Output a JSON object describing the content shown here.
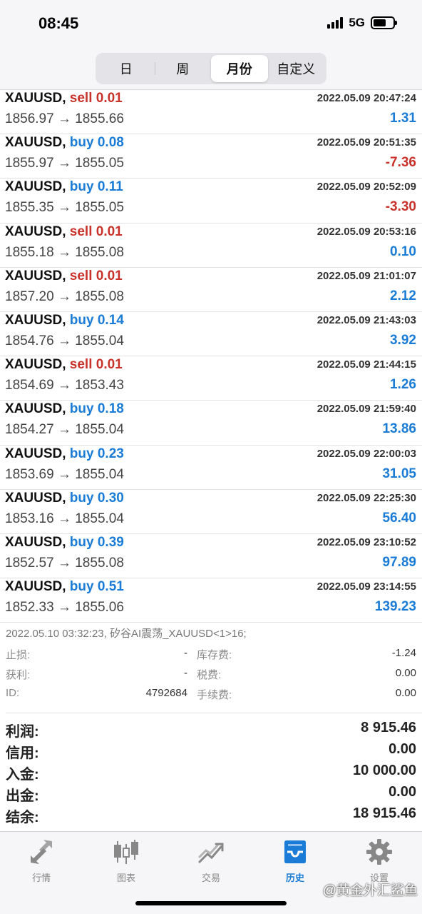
{
  "status_bar": {
    "time": "08:45",
    "network": "5G"
  },
  "segments": [
    {
      "label": "日",
      "active": false
    },
    {
      "label": "周",
      "active": false
    },
    {
      "label": "月份",
      "active": true
    },
    {
      "label": "自定义",
      "active": false
    }
  ],
  "trades": [
    {
      "symbol": "XAUUSD,",
      "side": "sell",
      "volume": "sell 0.01",
      "time": "2022.05.09 20:47:24",
      "prices": "1856.97 → 1855.66",
      "profit": "1.31"
    },
    {
      "symbol": "XAUUSD,",
      "side": "buy",
      "volume": "buy 0.08",
      "time": "2022.05.09 20:51:35",
      "prices": "1855.97 → 1855.05",
      "profit": "-7.36"
    },
    {
      "symbol": "XAUUSD,",
      "side": "buy",
      "volume": "buy 0.11",
      "time": "2022.05.09 20:52:09",
      "prices": "1855.35 → 1855.05",
      "profit": "-3.30"
    },
    {
      "symbol": "XAUUSD,",
      "side": "sell",
      "volume": "sell 0.01",
      "time": "2022.05.09 20:53:16",
      "prices": "1855.18 → 1855.08",
      "profit": "0.10"
    },
    {
      "symbol": "XAUUSD,",
      "side": "sell",
      "volume": "sell 0.01",
      "time": "2022.05.09 21:01:07",
      "prices": "1857.20 → 1855.08",
      "profit": "2.12"
    },
    {
      "symbol": "XAUUSD,",
      "side": "buy",
      "volume": "buy 0.14",
      "time": "2022.05.09 21:43:03",
      "prices": "1854.76 → 1855.04",
      "profit": "3.92"
    },
    {
      "symbol": "XAUUSD,",
      "side": "sell",
      "volume": "sell 0.01",
      "time": "2022.05.09 21:44:15",
      "prices": "1854.69 → 1853.43",
      "profit": "1.26"
    },
    {
      "symbol": "XAUUSD,",
      "side": "buy",
      "volume": "buy 0.18",
      "time": "2022.05.09 21:59:40",
      "prices": "1854.27 → 1855.04",
      "profit": "13.86"
    },
    {
      "symbol": "XAUUSD,",
      "side": "buy",
      "volume": "buy 0.23",
      "time": "2022.05.09 22:00:03",
      "prices": "1853.69 → 1855.04",
      "profit": "31.05"
    },
    {
      "symbol": "XAUUSD,",
      "side": "buy",
      "volume": "buy 0.30",
      "time": "2022.05.09 22:25:30",
      "prices": "1853.16 → 1855.04",
      "profit": "56.40"
    },
    {
      "symbol": "XAUUSD,",
      "side": "buy",
      "volume": "buy 0.39",
      "time": "2022.05.09 23:10:52",
      "prices": "1852.57 → 1855.08",
      "profit": "97.89"
    },
    {
      "symbol": "XAUUSD,",
      "side": "buy",
      "volume": "buy 0.51",
      "time": "2022.05.09 23:14:55",
      "prices": "1852.33 → 1855.06",
      "profit": "139.23"
    }
  ],
  "order_detail": {
    "line": "2022.05.10 03:32:23, 矽谷AI震荡_XAUUSD<1>16;",
    "rows": [
      {
        "label1": "止损:",
        "value1": "-",
        "label2": "库存费:",
        "value2": "-1.24"
      },
      {
        "label1": "获利:",
        "value1": "-",
        "label2": "税费:",
        "value2": "0.00"
      },
      {
        "label1": "ID:",
        "value1": "4792684",
        "label2": "手续费:",
        "value2": "0.00"
      }
    ]
  },
  "summary": [
    {
      "label": "利润:",
      "value": "8 915.46"
    },
    {
      "label": "信用:",
      "value": "0.00"
    },
    {
      "label": "入金:",
      "value": "10 000.00"
    },
    {
      "label": "出金:",
      "value": "0.00"
    },
    {
      "label": "结余:",
      "value": "18 915.46"
    }
  ],
  "tabbar": [
    {
      "label": "行情",
      "icon": "quotes-arrows-icon",
      "active": false
    },
    {
      "label": "图表",
      "icon": "candlestick-chart-icon",
      "active": false
    },
    {
      "label": "交易",
      "icon": "trade-trend-icon",
      "active": false
    },
    {
      "label": "历史",
      "icon": "history-inbox-icon",
      "active": true
    },
    {
      "label": "设置",
      "icon": "gear-icon",
      "active": false
    }
  ],
  "watermark": "@黄金外汇鲨鱼",
  "colors": {
    "buy": "#1a7cd6",
    "sell": "#c8322b",
    "profit_positive": "#1a7cd6",
    "profit_negative": "#c8322b"
  }
}
